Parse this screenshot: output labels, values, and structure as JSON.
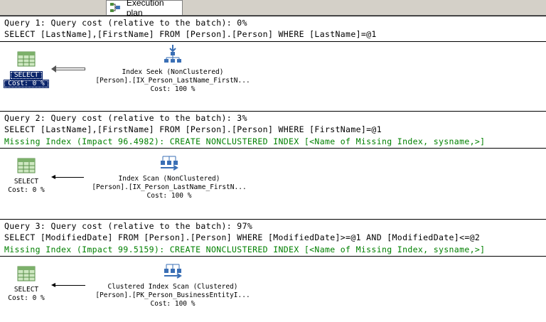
{
  "tab": {
    "label": "Execution plan",
    "icon": "execution-plan-icon"
  },
  "queries": [
    {
      "cost_line": "Query 1: Query cost (relative to the batch): 0%",
      "sql": "SELECT [LastName],[FirstName] FROM [Person].[Person] WHERE [LastName]=@1",
      "missing_index": "",
      "select": {
        "title": "SELECT",
        "cost": "Cost: 0 %"
      },
      "op": {
        "title": "Index Seek (NonClustered)",
        "object": "[Person].[IX_Person_LastName_FirstN...",
        "cost": "Cost: 100 %",
        "icon": "index-seek-icon"
      }
    },
    {
      "cost_line": "Query 2: Query cost (relative to the batch): 3%",
      "sql": "SELECT [LastName],[FirstName] FROM [Person].[Person] WHERE [FirstName]=@1",
      "missing_index": "Missing Index (Impact 96.4982): CREATE NONCLUSTERED INDEX [<Name of Missing Index, sysname,>]",
      "select": {
        "title": "SELECT",
        "cost": "Cost: 0 %"
      },
      "op": {
        "title": "Index Scan (NonClustered)",
        "object": "[Person].[IX_Person_LastName_FirstN...",
        "cost": "Cost: 100 %",
        "icon": "index-scan-icon"
      }
    },
    {
      "cost_line": "Query 3: Query cost (relative to the batch): 97%",
      "sql": "SELECT [ModifiedDate] FROM [Person].[Person] WHERE [ModifiedDate]>=@1 AND [ModifiedDate]<=@2",
      "missing_index": "Missing Index (Impact 99.5159): CREATE NONCLUSTERED INDEX [<Name of Missing Index, sysname,>]",
      "select": {
        "title": "SELECT",
        "cost": "Cost: 0 %"
      },
      "op": {
        "title": "Clustered Index Scan (Clustered)",
        "object": "[Person].[PK_Person_BusinessEntityI...",
        "cost": "Cost: 100 %",
        "icon": "clustered-index-scan-icon"
      }
    }
  ]
}
